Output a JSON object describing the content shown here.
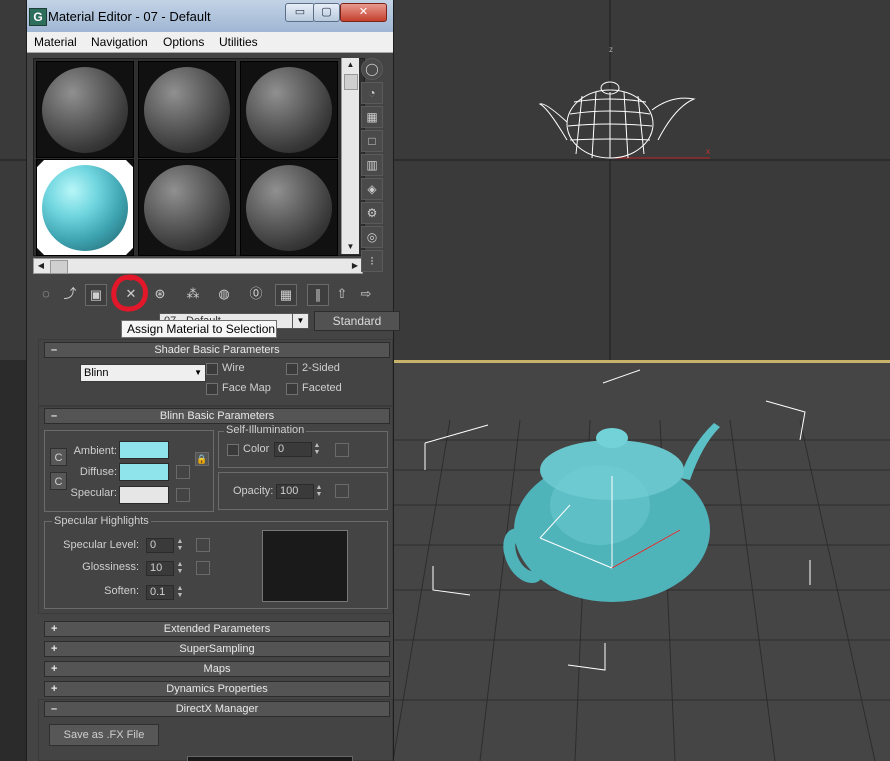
{
  "window": {
    "title": "Material Editor - 07 - Default",
    "logo": "G",
    "min_label": "▭",
    "max_label": "▢",
    "close_label": "✕"
  },
  "menu": [
    "Material",
    "Navigation",
    "Options",
    "Utilities"
  ],
  "tooltip": "Assign Material to Selection",
  "material": {
    "name": "07 - Default",
    "type": "Standard"
  },
  "rollouts": {
    "shader_basic": "Shader Basic Parameters",
    "blinn_basic": "Blinn Basic Parameters",
    "extended": "Extended Parameters",
    "supersampling": "SuperSampling",
    "maps": "Maps",
    "dynamics": "Dynamics Properties",
    "directx": "DirectX Manager"
  },
  "shader": {
    "selected": "Blinn",
    "wire": "Wire",
    "two_sided": "2-Sided",
    "face_map": "Face Map",
    "faceted": "Faceted"
  },
  "blinn": {
    "ambient": "Ambient:",
    "diffuse": "Diffuse:",
    "specular": "Specular:",
    "self_illum_title": "Self-Illumination",
    "color_label": "Color",
    "color_value": "0",
    "opacity_label": "Opacity:",
    "opacity_value": "100",
    "lock_c": "C"
  },
  "specular_highlights": {
    "title": "Specular Highlights",
    "level_label": "Specular Level:",
    "level_value": "0",
    "gloss_label": "Glossiness:",
    "gloss_value": "10",
    "soften_label": "Soften:",
    "soften_value": "0.1"
  },
  "directx": {
    "save_button": "Save as .FX File"
  },
  "colors": {
    "ambient": "#8fe3ea",
    "diffuse": "#8fe3ea",
    "specular": "#e6e6e6",
    "teapot": "#4fb3ba",
    "selection_red": "#e2182a"
  },
  "viewports": {
    "axis_z": "z",
    "axis_x": "x"
  }
}
